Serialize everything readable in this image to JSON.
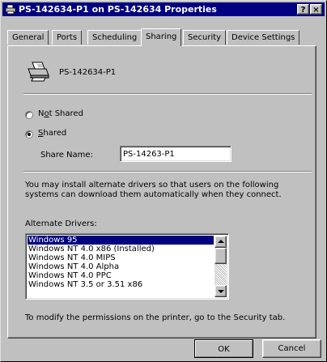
{
  "window": {
    "title": "PS-142634-P1 on PS-142634 Properties",
    "help_button": "?",
    "close_button": "×"
  },
  "tabs": [
    {
      "label": "General"
    },
    {
      "label": "Ports"
    },
    {
      "label": "Scheduling"
    },
    {
      "label": "Sharing",
      "active": true
    },
    {
      "label": "Security"
    },
    {
      "label": "Device Settings"
    }
  ],
  "printer": {
    "name": "PS-142634-P1",
    "icon": "printer-icon"
  },
  "sharing": {
    "not_shared_prefix": "N",
    "not_shared_mnemonic": "o",
    "not_shared_suffix": "t Shared",
    "shared_mnemonic": "S",
    "shared_suffix": "hared",
    "selected": "shared",
    "share_name_label": "Share Name:",
    "share_name_value": "PS-14263-P1"
  },
  "info_text": "You may install alternate drivers so that users on the following systems can download them automatically when they connect.",
  "alternate_drivers": {
    "label": "Alternate Drivers:",
    "items": [
      "Windows 95",
      "Windows NT 4.0 x86 (Installed)",
      "Windows NT 4.0 MIPS",
      "Windows NT 4.0 Alpha",
      "Windows NT 4.0 PPC",
      "Windows NT 3.5 or 3.51 x86"
    ],
    "selected_index": 0
  },
  "footer_note": "To modify the permissions on the printer, go to the Security tab.",
  "buttons": {
    "ok": "OK",
    "cancel": "Cancel"
  }
}
